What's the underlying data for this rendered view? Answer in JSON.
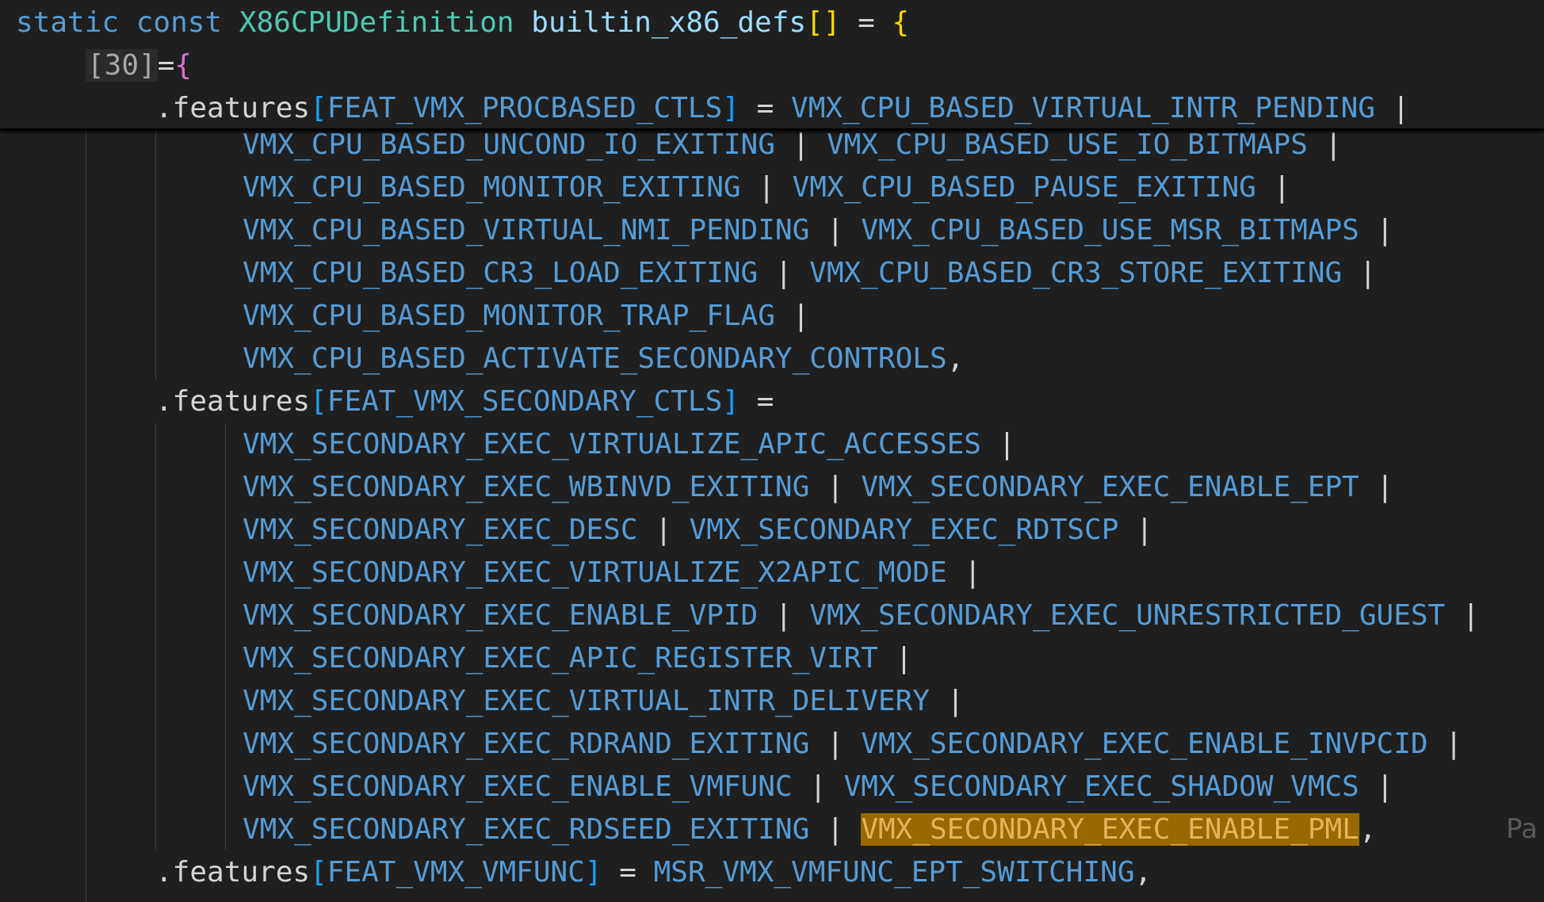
{
  "header": {
    "static_kw": "static",
    "const_kw": "const",
    "type_name": "X86CPUDefinition",
    "var_name": "builtin_x86_defs",
    "brackets": "[]",
    "assign": "=",
    "open_brace": "{"
  },
  "index": {
    "label": "[30]",
    "eq": "=",
    "brace": "{"
  },
  "features": [
    {
      "prefix": ".features",
      "key": "FEAT_VMX_PROCBASED_CTLS",
      "first_value": "VMX_CPU_BASED_VIRTUAL_INTR_PENDING",
      "lines": [
        [
          "VMX_CPU_BASED_UNCOND_IO_EXITING",
          "VMX_CPU_BASED_USE_IO_BITMAPS"
        ],
        [
          "VMX_CPU_BASED_MONITOR_EXITING",
          "VMX_CPU_BASED_PAUSE_EXITING"
        ],
        [
          "VMX_CPU_BASED_VIRTUAL_NMI_PENDING",
          "VMX_CPU_BASED_USE_MSR_BITMAPS"
        ],
        [
          "VMX_CPU_BASED_CR3_LOAD_EXITING",
          "VMX_CPU_BASED_CR3_STORE_EXITING"
        ],
        [
          "VMX_CPU_BASED_MONITOR_TRAP_FLAG"
        ],
        [
          "VMX_CPU_BASED_ACTIVATE_SECONDARY_CONTROLS"
        ]
      ]
    },
    {
      "prefix": ".features",
      "key": "FEAT_VMX_SECONDARY_CTLS",
      "lines": [
        [
          "VMX_SECONDARY_EXEC_VIRTUALIZE_APIC_ACCESSES"
        ],
        [
          "VMX_SECONDARY_EXEC_WBINVD_EXITING",
          "VMX_SECONDARY_EXEC_ENABLE_EPT"
        ],
        [
          "VMX_SECONDARY_EXEC_DESC",
          "VMX_SECONDARY_EXEC_RDTSCP"
        ],
        [
          "VMX_SECONDARY_EXEC_VIRTUALIZE_X2APIC_MODE"
        ],
        [
          "VMX_SECONDARY_EXEC_ENABLE_VPID",
          "VMX_SECONDARY_EXEC_UNRESTRICTED_GUEST"
        ],
        [
          "VMX_SECONDARY_EXEC_APIC_REGISTER_VIRT"
        ],
        [
          "VMX_SECONDARY_EXEC_VIRTUAL_INTR_DELIVERY"
        ],
        [
          "VMX_SECONDARY_EXEC_RDRAND_EXITING",
          "VMX_SECONDARY_EXEC_ENABLE_INVPCID"
        ],
        [
          "VMX_SECONDARY_EXEC_ENABLE_VMFUNC",
          "VMX_SECONDARY_EXEC_SHADOW_VMCS"
        ],
        [
          "VMX_SECONDARY_EXEC_RDSEED_EXITING",
          "VMX_SECONDARY_EXEC_ENABLE_PML"
        ]
      ]
    },
    {
      "prefix": ".features",
      "key": "FEAT_VMX_VMFUNC",
      "value": "MSR_VMX_VMFUNC_EPT_SWITCHING"
    }
  ],
  "ops": {
    "pipe": "|",
    "comma": ",",
    "eq": "="
  },
  "ghost_text": "Pa",
  "colors": {
    "background": "#1f1f1f",
    "keyword": "#569cd6",
    "type": "#4ec9b0",
    "identifier": "#9cdcfe",
    "macro": "#569cd6",
    "highlight": "#9a6700"
  }
}
